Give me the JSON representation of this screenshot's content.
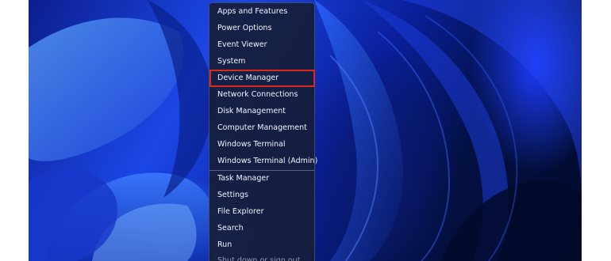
{
  "context_menu": {
    "items": [
      {
        "label": "Apps and Features"
      },
      {
        "label": "Power Options"
      },
      {
        "label": "Event Viewer"
      },
      {
        "label": "System"
      },
      {
        "label": "Device Manager"
      },
      {
        "label": "Network Connections"
      },
      {
        "label": "Disk Management"
      },
      {
        "label": "Computer Management"
      },
      {
        "label": "Windows Terminal"
      },
      {
        "label": "Windows Terminal (Admin)"
      },
      {
        "label": "Task Manager"
      },
      {
        "label": "Settings"
      },
      {
        "label": "File Explorer"
      },
      {
        "label": "Search"
      },
      {
        "label": "Run"
      },
      {
        "label": "Shut down or sign out"
      }
    ],
    "highlighted_item": "Device Manager",
    "highlight_color": "#d92a1c"
  },
  "colors": {
    "wallpaper_primary": "#1b47e6",
    "wallpaper_dark": "#020a2a"
  }
}
